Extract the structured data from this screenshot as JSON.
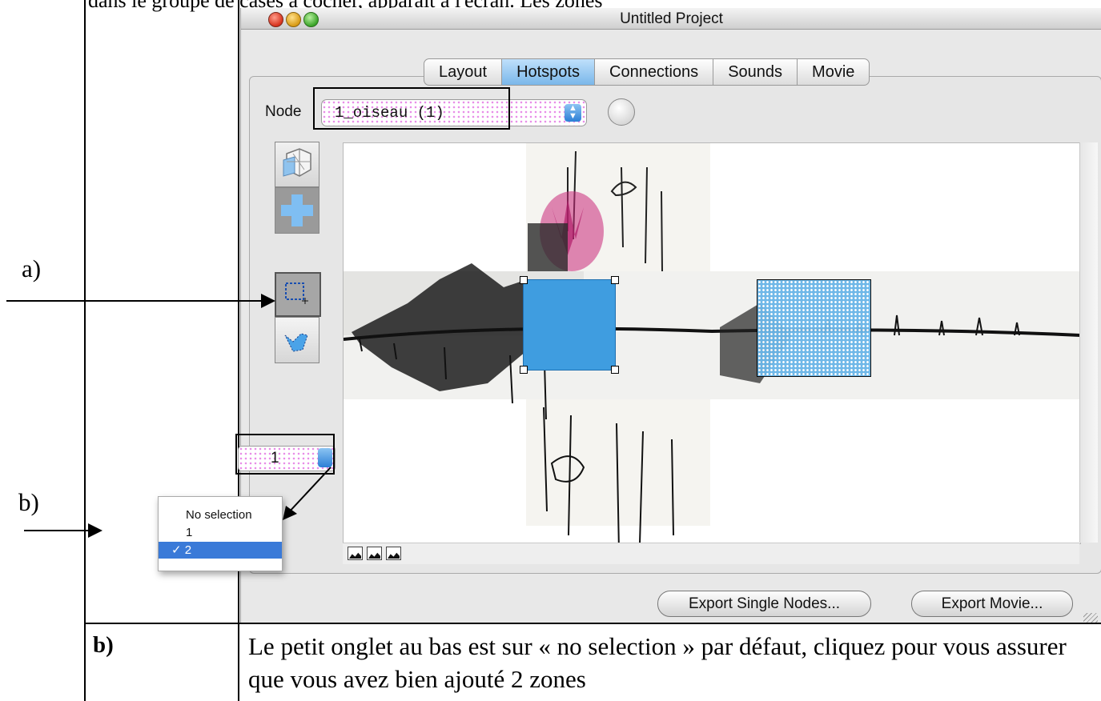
{
  "document": {
    "top_text": "dans le groupe de cases à cocher, apparaît à l'écran. Les zones",
    "label_a": "a)",
    "label_b": "b)",
    "row_label": "b)",
    "row_text": "Le petit onglet au bas est sur « no selection » par défaut, cliquez pour vous assurer que vous avez bien ajouté  2 zones"
  },
  "window": {
    "title": "Untitled Project",
    "tabs": [
      {
        "label": "Layout",
        "active": false
      },
      {
        "label": "Hotspots",
        "active": true
      },
      {
        "label": "Connections",
        "active": false
      },
      {
        "label": "Sounds",
        "active": false
      },
      {
        "label": "Movie",
        "active": false
      }
    ],
    "node_label": "Node",
    "node_value": "1_oiseau (1)",
    "zone_value": "1",
    "zone_options": [
      {
        "label": "No selection",
        "checked": false
      },
      {
        "label": "1",
        "checked": false
      },
      {
        "label": "2",
        "checked": true
      }
    ],
    "check_mark": "✓",
    "export_single_label": "Export Single Nodes...",
    "export_movie_label": "Export Movie..."
  },
  "colors": {
    "hotspot": "#3f9de0",
    "tab_active": "#7ab7ea",
    "highlight_dots": "#e88ee8",
    "popup_selection": "#3a7ad8"
  },
  "icons": [
    "cube-view-icon",
    "add-plus-icon",
    "rectangle-select-icon",
    "polygon-select-icon",
    "landscape-icon",
    "hill-icon",
    "city-icon"
  ]
}
